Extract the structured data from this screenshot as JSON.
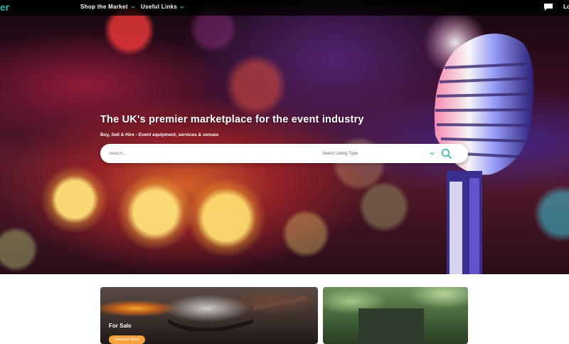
{
  "header": {
    "logo_fragment": "er",
    "nav": [
      {
        "label": "Shop the Market"
      },
      {
        "label": "Useful Links"
      }
    ],
    "chat_icon": "chat-bubble-icon",
    "login_fragment": "Lo"
  },
  "hero": {
    "title": "The UK's premier marketplace for the event industry",
    "subtitle": "Buy, Sell & Hire - Event equipment, services & venues",
    "search": {
      "placeholder": "Search...",
      "listing_type_label": "Select Listing Type",
      "search_icon": "search-icon"
    }
  },
  "cards": [
    {
      "title": "For Sale",
      "button_label": "Discover More"
    },
    {
      "title": "",
      "button_label": ""
    }
  ],
  "colors": {
    "accent": "#2fb6b0",
    "button_orange": "#f5a33a",
    "topbar": "#000000"
  }
}
